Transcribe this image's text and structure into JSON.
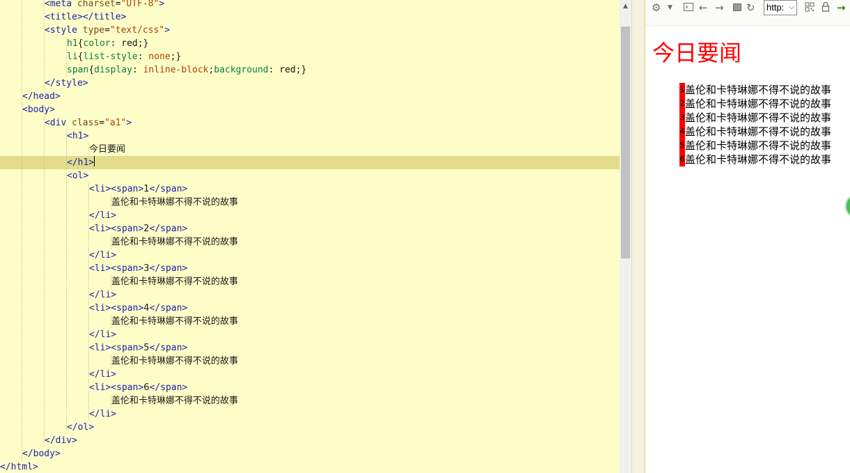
{
  "editor": {
    "lines": [
      {
        "indent": 2,
        "tokens": [
          [
            "tag",
            "<meta "
          ],
          [
            "attr",
            "charset"
          ],
          [
            "pun",
            "="
          ],
          [
            "str",
            "\"UTF-8\""
          ],
          [
            "tag",
            ">"
          ]
        ]
      },
      {
        "indent": 2,
        "tokens": [
          [
            "tag",
            "<title></title>"
          ]
        ]
      },
      {
        "indent": 2,
        "tokens": [
          [
            "tag",
            "<style "
          ],
          [
            "attr",
            "type"
          ],
          [
            "pun",
            "="
          ],
          [
            "str",
            "\"text/css\""
          ],
          [
            "tag",
            ">"
          ]
        ]
      },
      {
        "indent": 3,
        "tokens": [
          [
            "prop",
            "h1"
          ],
          [
            "pun",
            "{"
          ],
          [
            "prop",
            "color"
          ],
          [
            "pun",
            ": "
          ],
          [
            "val",
            "red"
          ],
          [
            "pun",
            ";}"
          ]
        ]
      },
      {
        "indent": 3,
        "tokens": [
          [
            "prop",
            "li"
          ],
          [
            "pun",
            "{"
          ],
          [
            "prop",
            "list-style"
          ],
          [
            "pun",
            ": "
          ],
          [
            "str",
            "none"
          ],
          [
            "pun",
            ";}"
          ]
        ]
      },
      {
        "indent": 3,
        "tokens": [
          [
            "prop",
            "span"
          ],
          [
            "pun",
            "{"
          ],
          [
            "prop",
            "display"
          ],
          [
            "pun",
            ": "
          ],
          [
            "str",
            "inline-block"
          ],
          [
            "pun",
            ";"
          ],
          [
            "prop",
            "background"
          ],
          [
            "pun",
            ": "
          ],
          [
            "val",
            "red"
          ],
          [
            "pun",
            ";}"
          ]
        ]
      },
      {
        "indent": 2,
        "tokens": [
          [
            "tag",
            "</style>"
          ]
        ]
      },
      {
        "indent": 1,
        "tokens": [
          [
            "tag",
            "</head>"
          ]
        ]
      },
      {
        "indent": 1,
        "tokens": [
          [
            "tag",
            "<body>"
          ]
        ]
      },
      {
        "indent": 2,
        "tokens": [
          [
            "tag",
            "<div "
          ],
          [
            "attr",
            "class"
          ],
          [
            "pun",
            "="
          ],
          [
            "str",
            "\"a1\""
          ],
          [
            "tag",
            ">"
          ]
        ]
      },
      {
        "indent": 3,
        "tokens": [
          [
            "tag",
            "<h1>"
          ]
        ]
      },
      {
        "indent": 4,
        "tokens": [
          [
            "txt",
            "今日要闻"
          ]
        ]
      },
      {
        "indent": 3,
        "tokens": [
          [
            "tag",
            "</h1>"
          ],
          [
            "caret",
            ""
          ]
        ],
        "current": true
      },
      {
        "indent": 3,
        "tokens": [
          [
            "tag",
            "<ol>"
          ]
        ]
      },
      {
        "indent": 4,
        "tokens": [
          [
            "tag",
            "<li><span>"
          ],
          [
            "txt",
            "1"
          ],
          [
            "tag",
            "</span>"
          ]
        ]
      },
      {
        "indent": 5,
        "tokens": [
          [
            "txt",
            "盖伦和卡特琳娜不得不说的故事"
          ]
        ]
      },
      {
        "indent": 4,
        "tokens": [
          [
            "tag",
            "</li>"
          ]
        ]
      },
      {
        "indent": 4,
        "tokens": [
          [
            "tag",
            "<li><span>"
          ],
          [
            "txt",
            "2"
          ],
          [
            "tag",
            "</span>"
          ]
        ]
      },
      {
        "indent": 5,
        "tokens": [
          [
            "txt",
            "盖伦和卡特琳娜不得不说的故事"
          ]
        ]
      },
      {
        "indent": 4,
        "tokens": [
          [
            "tag",
            "</li>"
          ]
        ]
      },
      {
        "indent": 4,
        "tokens": [
          [
            "tag",
            "<li><span>"
          ],
          [
            "txt",
            "3"
          ],
          [
            "tag",
            "</span>"
          ]
        ]
      },
      {
        "indent": 5,
        "tokens": [
          [
            "txt",
            "盖伦和卡特琳娜不得不说的故事"
          ]
        ]
      },
      {
        "indent": 4,
        "tokens": [
          [
            "tag",
            "</li>"
          ]
        ]
      },
      {
        "indent": 4,
        "tokens": [
          [
            "tag",
            "<li><span>"
          ],
          [
            "txt",
            "4"
          ],
          [
            "tag",
            "</span>"
          ]
        ]
      },
      {
        "indent": 5,
        "tokens": [
          [
            "txt",
            "盖伦和卡特琳娜不得不说的故事"
          ]
        ]
      },
      {
        "indent": 4,
        "tokens": [
          [
            "tag",
            "</li>"
          ]
        ]
      },
      {
        "indent": 4,
        "tokens": [
          [
            "tag",
            "<li><span>"
          ],
          [
            "txt",
            "5"
          ],
          [
            "tag",
            "</span>"
          ]
        ]
      },
      {
        "indent": 5,
        "tokens": [
          [
            "txt",
            "盖伦和卡特琳娜不得不说的故事"
          ]
        ]
      },
      {
        "indent": 4,
        "tokens": [
          [
            "tag",
            "</li>"
          ]
        ]
      },
      {
        "indent": 4,
        "tokens": [
          [
            "tag",
            "<li><span>"
          ],
          [
            "txt",
            "6"
          ],
          [
            "tag",
            "</span>"
          ]
        ]
      },
      {
        "indent": 5,
        "tokens": [
          [
            "txt",
            "盖伦和卡特琳娜不得不说的故事"
          ]
        ]
      },
      {
        "indent": 4,
        "tokens": [
          [
            "tag",
            "</li>"
          ]
        ]
      },
      {
        "indent": 3,
        "tokens": [
          [
            "tag",
            "</ol>"
          ]
        ]
      },
      {
        "indent": 2,
        "tokens": [
          [
            "tag",
            "</div>"
          ]
        ]
      },
      {
        "indent": 1,
        "tokens": [
          [
            "tag",
            "</body>"
          ]
        ]
      },
      {
        "indent": 0,
        "tokens": [
          [
            "tag",
            "</html>"
          ]
        ]
      }
    ]
  },
  "preview_toolbar": {
    "icons": [
      "gear-icon",
      "dropdown-caret-icon",
      "console-icon",
      "back-arrow-icon",
      "forward-arrow-icon",
      "stop-icon",
      "refresh-icon"
    ],
    "url_select_value": "http:",
    "right_icons": [
      "qr-code-icon",
      "lock-icon",
      "go-arrow-icon"
    ]
  },
  "preview_page": {
    "heading": "今日要闻",
    "items": [
      {
        "num": "1",
        "text": "盖伦和卡特琳娜不得不说的故事"
      },
      {
        "num": "2",
        "text": "盖伦和卡特琳娜不得不说的故事"
      },
      {
        "num": "3",
        "text": "盖伦和卡特琳娜不得不说的故事"
      },
      {
        "num": "4",
        "text": "盖伦和卡特琳娜不得不说的故事"
      },
      {
        "num": "5",
        "text": "盖伦和卡特琳娜不得不说的故事"
      },
      {
        "num": "6",
        "text": "盖伦和卡特琳娜不得不说的故事"
      }
    ]
  }
}
